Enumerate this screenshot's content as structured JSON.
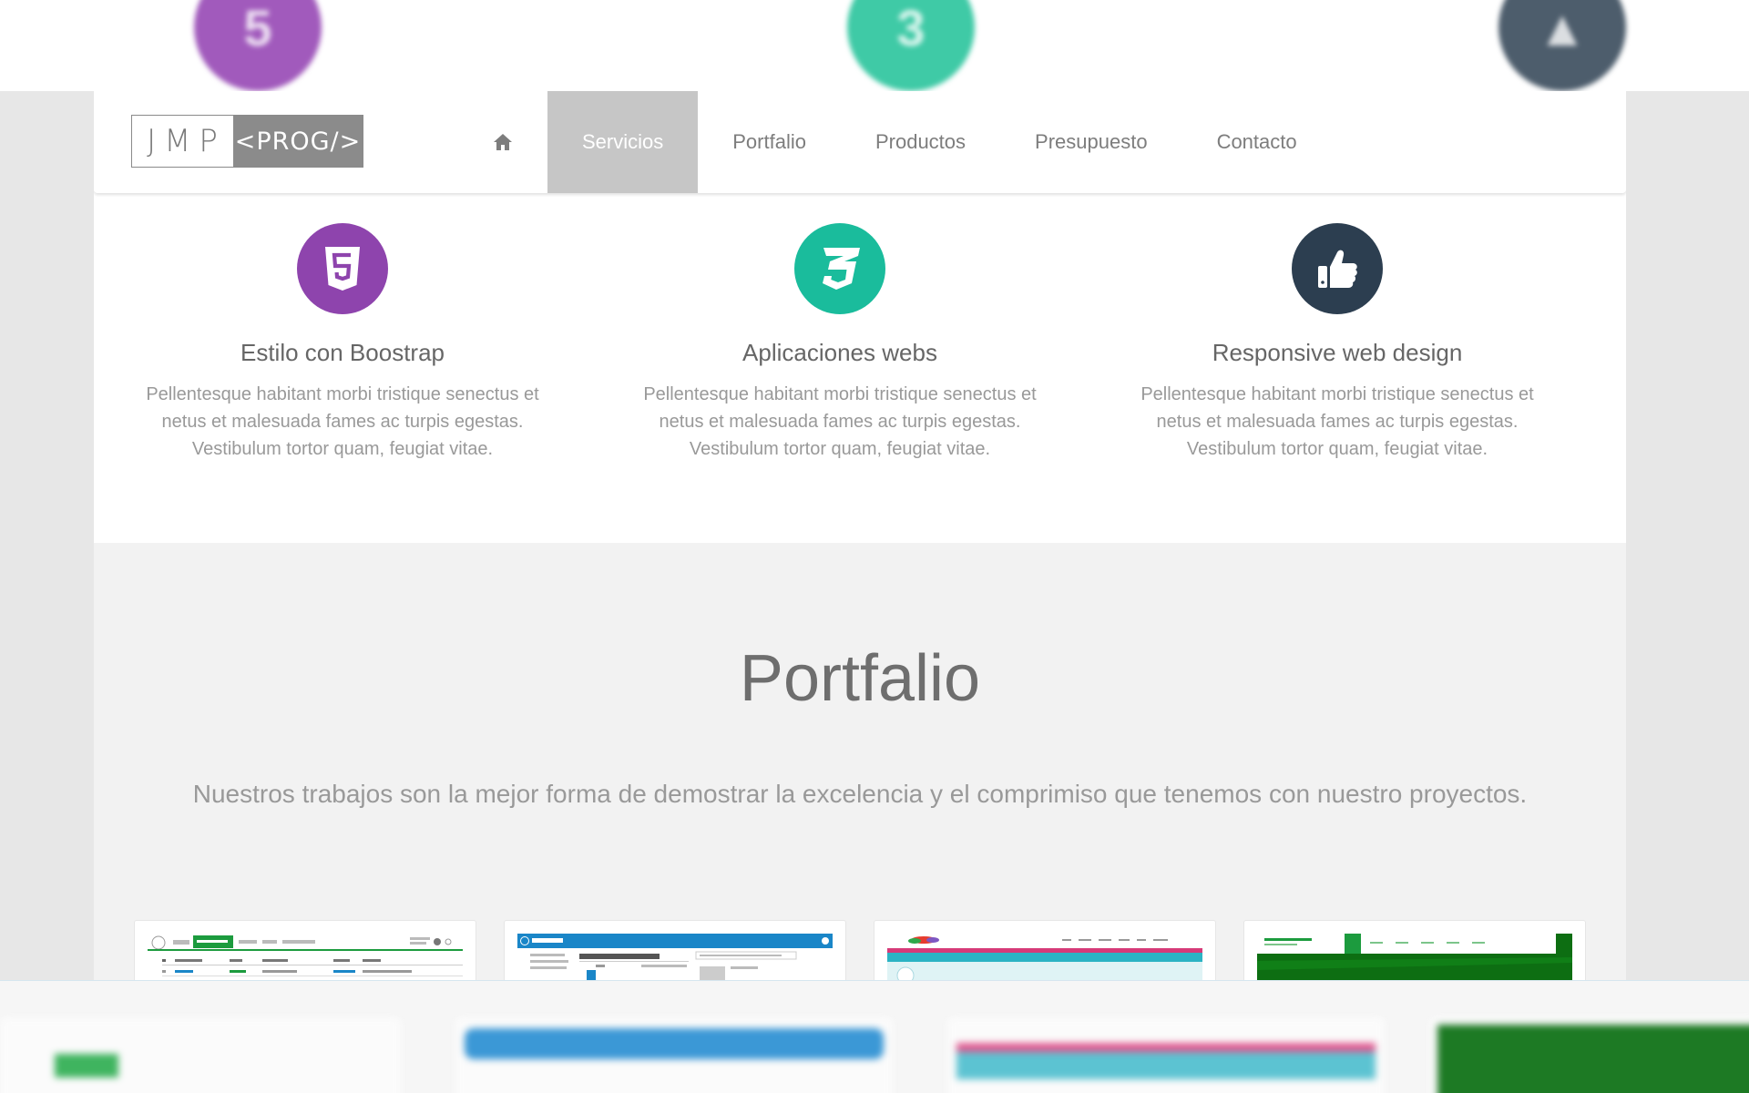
{
  "logo": {
    "left": "JMP",
    "right": "<PROG/>"
  },
  "nav": {
    "home_icon": "home-icon",
    "items": [
      {
        "label": "Servicios",
        "active": true
      },
      {
        "label": "Portfalio",
        "active": false
      },
      {
        "label": "Productos",
        "active": false
      },
      {
        "label": "Presupuesto",
        "active": false
      },
      {
        "label": "Contacto",
        "active": false
      }
    ]
  },
  "services": [
    {
      "icon": "html5-icon",
      "color": "#8e44ad",
      "title": "Estilo con Boostrap",
      "text": "Pellentesque habitant morbi tristique senectus et netus et malesuada fames ac turpis egestas. Vestibulum tortor quam, feugiat vitae."
    },
    {
      "icon": "css3-icon",
      "color": "#1abc9c",
      "title": "Aplicaciones webs",
      "text": "Pellentesque habitant morbi tristique senectus et netus et malesuada fames ac turpis egestas. Vestibulum tortor quam, feugiat vitae."
    },
    {
      "icon": "thumbs-up-icon",
      "color": "#2c3e50",
      "title": "Responsive web design",
      "text": "Pellentesque habitant morbi tristique senectus et netus et malesuada fames ac turpis egestas. Vestibulum tortor quam, feugiat vitae."
    }
  ],
  "portfolio": {
    "title": "Portfalio",
    "subtitle": "Nuestros trabajos son la mejor forma de demostrar la excelencia y el comprimiso que tenemos con nuestro proyectos."
  },
  "colors": {
    "nav_active_bg": "#c6c6c6",
    "portfolio_bg": "#f2f2f2",
    "thumb_green": "#1c9b3e",
    "thumb_blue": "#1a86c8",
    "thumb_pink": "#d63a78",
    "thumb_dark_green": "#0d6e12"
  }
}
